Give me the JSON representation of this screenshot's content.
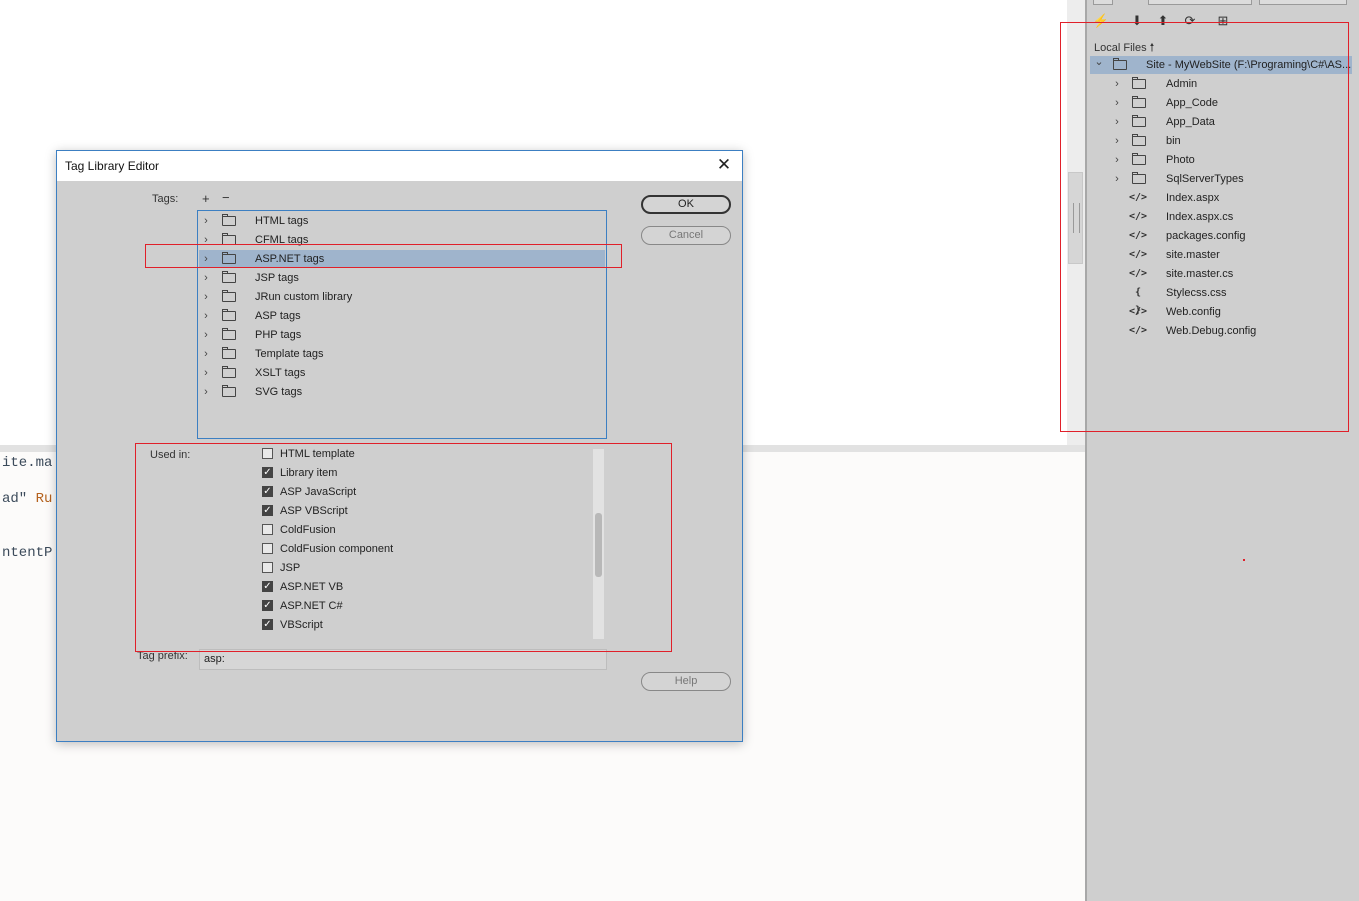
{
  "code_view": {
    "line1": "ite.ma",
    "line2_a": "ad\" ",
    "line2_b": "Ru",
    "line3": "ntentP"
  },
  "files_panel": {
    "local_files_label": "Local Files",
    "tree": [
      {
        "label": "Site - MyWebSite (F:\\Programing\\C#\\AS...",
        "type": "site"
      },
      {
        "label": "Admin",
        "type": "folder"
      },
      {
        "label": "App_Code",
        "type": "folder"
      },
      {
        "label": "App_Data",
        "type": "folder"
      },
      {
        "label": "bin",
        "type": "folder"
      },
      {
        "label": "Photo",
        "type": "folder"
      },
      {
        "label": "SqlServerTypes",
        "type": "folder"
      },
      {
        "label": "Index.aspx",
        "type": "code"
      },
      {
        "label": "Index.aspx.cs",
        "type": "code"
      },
      {
        "label": "packages.config",
        "type": "code"
      },
      {
        "label": "site.master",
        "type": "code"
      },
      {
        "label": "site.master.cs",
        "type": "code"
      },
      {
        "label": "Stylecss.css",
        "type": "css"
      },
      {
        "label": "Web.config",
        "type": "code"
      },
      {
        "label": "Web.Debug.config",
        "type": "code"
      }
    ],
    "icons": {
      "code": "</>",
      "css": "{ }"
    }
  },
  "dialog": {
    "title": "Tag Library Editor",
    "tags_label": "Tags:",
    "tags": [
      {
        "label": "HTML tags",
        "selected": false
      },
      {
        "label": "CFML tags",
        "selected": false
      },
      {
        "label": "ASP.NET tags",
        "selected": true
      },
      {
        "label": "JSP tags",
        "selected": false
      },
      {
        "label": "JRun custom library",
        "selected": false
      },
      {
        "label": "ASP tags",
        "selected": false
      },
      {
        "label": "PHP tags",
        "selected": false
      },
      {
        "label": "Template tags",
        "selected": false
      },
      {
        "label": "XSLT tags",
        "selected": false
      },
      {
        "label": "SVG tags",
        "selected": false
      }
    ],
    "ok_label": "OK",
    "cancel_label": "Cancel",
    "help_label": "Help",
    "used_in_label": "Used in:",
    "used_in": [
      {
        "label": "HTML template",
        "checked": false
      },
      {
        "label": "Library item",
        "checked": true
      },
      {
        "label": "ASP JavaScript",
        "checked": true
      },
      {
        "label": "ASP VBScript",
        "checked": true
      },
      {
        "label": "ColdFusion",
        "checked": false
      },
      {
        "label": "ColdFusion component",
        "checked": false
      },
      {
        "label": "JSP",
        "checked": false
      },
      {
        "label": "ASP.NET VB",
        "checked": true
      },
      {
        "label": "ASP.NET C#",
        "checked": true
      },
      {
        "label": "VBScript",
        "checked": true
      }
    ],
    "tag_prefix_label": "Tag prefix:",
    "tag_prefix_value": "asp:"
  },
  "colors": {
    "selection": "#9fb4cc",
    "annotation_red": "#e0202a",
    "dialog_border": "#3c7fc2"
  }
}
